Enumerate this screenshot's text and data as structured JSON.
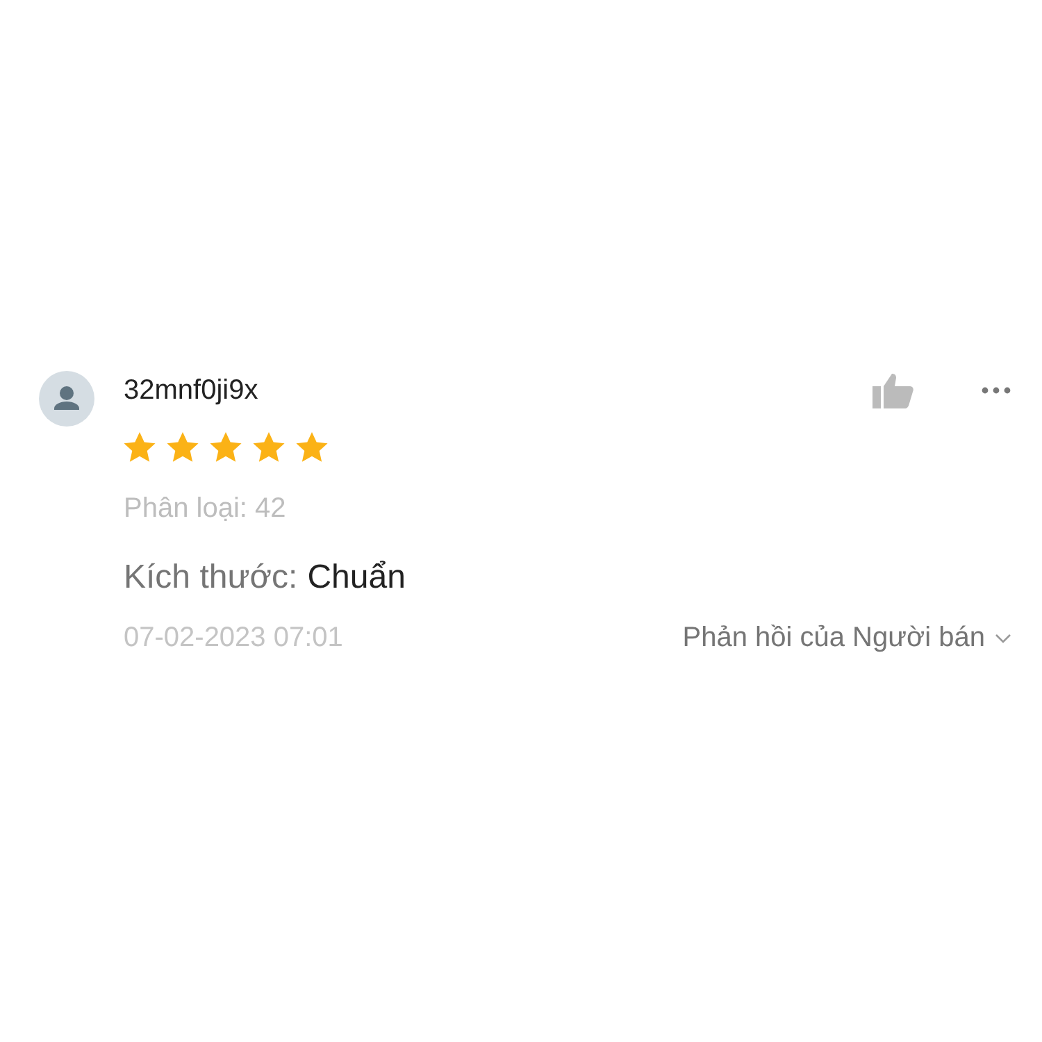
{
  "review": {
    "username": "32mnf0ji9x",
    "stars": 5,
    "variation": "Phân loại: 42",
    "size_label": "Kích thước:",
    "size_value": "Chuẩn",
    "date": "07-02-2023 07:01",
    "seller_reply": "Phản hồi của Người bán"
  }
}
